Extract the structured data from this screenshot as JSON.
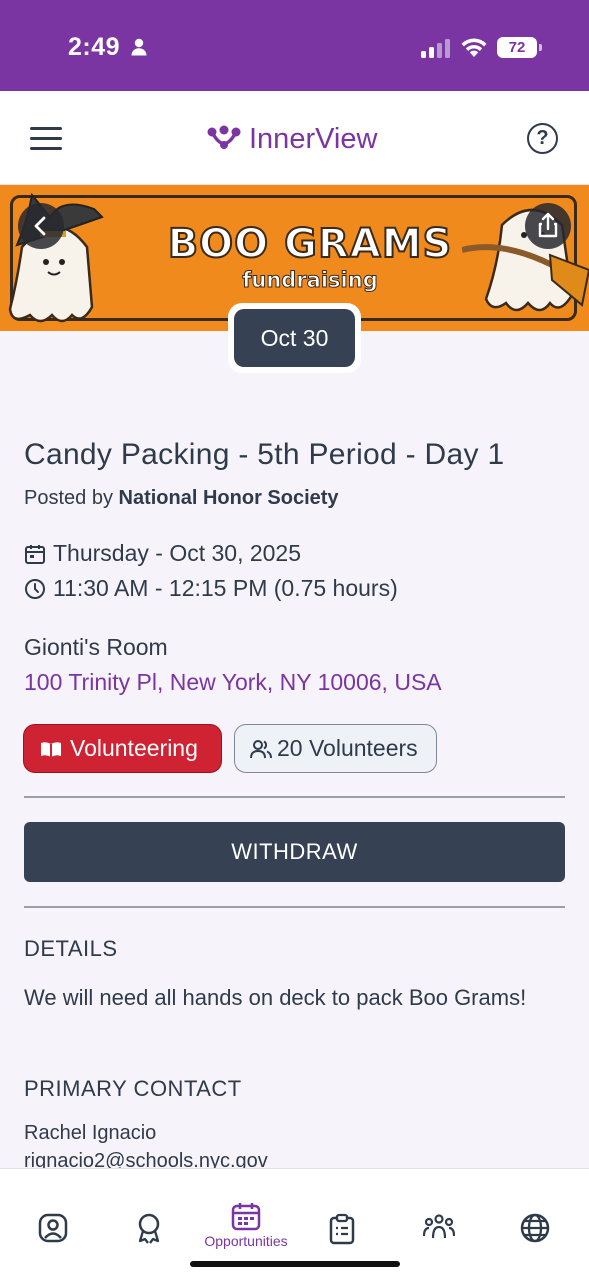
{
  "status_bar": {
    "time": "2:49",
    "battery": "72"
  },
  "header": {
    "brand": "InnerView"
  },
  "banner": {
    "title": "BOO GRAMS",
    "subtitle": "fundraising"
  },
  "event": {
    "date_badge": "Oct 30",
    "title": "Candy Packing - 5th Period - Day 1",
    "posted_prefix": "Posted by",
    "posted_by": "National Honor Society",
    "date": "Thursday - Oct 30, 2025",
    "time": "11:30 AM - 12:15 PM (0.75 hours)",
    "location": "Gionti's Room",
    "address": "100 Trinity Pl, New York, NY 10006, USA",
    "category": "Volunteering",
    "volunteers": "20 Volunteers",
    "action_label": "WITHDRAW"
  },
  "details": {
    "heading": "DETAILS",
    "text": "We will need all hands on deck to pack Boo Grams!"
  },
  "primary_contact": {
    "heading": "PRIMARY CONTACT",
    "name": "Rachel Ignacio",
    "email": "rignacio2@schools.nyc.gov"
  },
  "tabbar": {
    "active": "Opportunities",
    "tabs": [
      "profile-icon",
      "award-icon",
      "Opportunities",
      "clipboard-icon",
      "community-icon",
      "globe-icon"
    ]
  },
  "colors": {
    "brand": "#7a35a3",
    "dark": "#364154",
    "volunteering": "#cf2233",
    "banner": "#f08a1c"
  }
}
